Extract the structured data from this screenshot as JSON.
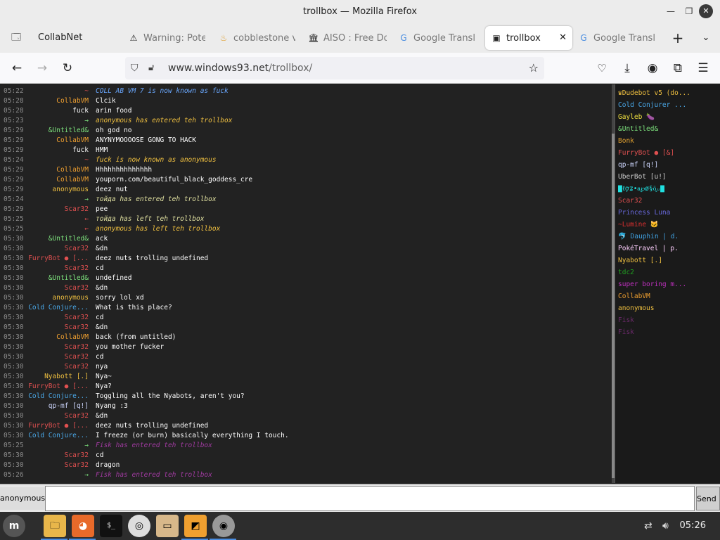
{
  "window": {
    "title": "trollbox — Mozilla Firefox"
  },
  "tabs": [
    {
      "label": "CollabNet",
      "icon": "tab-list-icon"
    },
    {
      "label": "Warning: Pote",
      "icon": "warning-icon"
    },
    {
      "label": "cobblestone v",
      "icon": "flame-icon"
    },
    {
      "label": "AISO : Free Do",
      "icon": "archive-icon"
    },
    {
      "label": "Google Transl",
      "icon": "translate-icon"
    },
    {
      "label": "trollbox",
      "icon": "trollbox-icon"
    },
    {
      "label": "Google Transl",
      "icon": "translate-icon"
    }
  ],
  "nav": {
    "url_host": "www.windows93.net",
    "url_path": "/trollbox/"
  },
  "colors": {
    "time": "#8a8a8a",
    "system_arrow": "#7ce07c",
    "leave_arrow": "#e05050"
  },
  "messages": [
    {
      "time": "05:22",
      "nick": "~",
      "nick_color": "#e05050",
      "text": "",
      "sys": "COLL AB VM 7 is now known as fuck",
      "sys_color": "#6aa8ff"
    },
    {
      "time": "05:28",
      "nick": "CollabVM",
      "nick_color": "#f0a030",
      "text": "Clcik"
    },
    {
      "time": "05:28",
      "nick": "fuck",
      "nick_color": "#f5f5f5",
      "text": "arin food"
    },
    {
      "time": "05:23",
      "nick": "→",
      "nick_color": "#7ce07c",
      "text": "",
      "sys": "anonymous has entered teh trollbox",
      "sys_color": "#f0c040"
    },
    {
      "time": "05:29",
      "nick": "&Untitled&",
      "nick_color": "#7ce07c",
      "text": "oh god no"
    },
    {
      "time": "05:29",
      "nick": "CollabVM",
      "nick_color": "#f0a030",
      "text": "ANYNYMOOOOSE GONG TO HACK"
    },
    {
      "time": "05:29",
      "nick": "fuck",
      "nick_color": "#f5f5f5",
      "text": "HMM"
    },
    {
      "time": "05:24",
      "nick": "~",
      "nick_color": "#e05050",
      "text": "",
      "sys": "fuck is now known as anonymous",
      "sys_color": "#f0c040"
    },
    {
      "time": "05:29",
      "nick": "CollabVM",
      "nick_color": "#f0a030",
      "text": "Hhhhhhhhhhhhhh"
    },
    {
      "time": "05:29",
      "nick": "CollabVM",
      "nick_color": "#f0a030",
      "text": "youporn.com/beautiful_black_goddess_cre"
    },
    {
      "time": "05:29",
      "nick": "anonymous",
      "nick_color": "#f0c040",
      "text": "deez nut"
    },
    {
      "time": "05:24",
      "nick": "→",
      "nick_color": "#7ce07c",
      "text": "",
      "sys": "тойда has entered teh trollbox",
      "sys_color": "#e0e0a0"
    },
    {
      "time": "05:29",
      "nick": "Scar32",
      "nick_color": "#e05050",
      "text": "pee"
    },
    {
      "time": "05:25",
      "nick": "←",
      "nick_color": "#e05050",
      "text": "",
      "sys": "тойда has left teh trollbox",
      "sys_color": "#e0e0a0"
    },
    {
      "time": "05:25",
      "nick": "←",
      "nick_color": "#e05050",
      "text": "",
      "sys": "anonymous has left teh trollbox",
      "sys_color": "#f0c040"
    },
    {
      "time": "05:30",
      "nick": "&Untitled&",
      "nick_color": "#7ce07c",
      "text": "ack"
    },
    {
      "time": "05:30",
      "nick": "Scar32",
      "nick_color": "#e05050",
      "text": "&dn"
    },
    {
      "time": "05:30",
      "nick": "FurryBot ● [...",
      "nick_color": "#e05050",
      "text": "deez nuts trolling undefined"
    },
    {
      "time": "05:30",
      "nick": "Scar32",
      "nick_color": "#e05050",
      "text": "cd"
    },
    {
      "time": "05:30",
      "nick": "&Untitled&",
      "nick_color": "#7ce07c",
      "text": "undefined"
    },
    {
      "time": "05:30",
      "nick": "Scar32",
      "nick_color": "#e05050",
      "text": "&dn"
    },
    {
      "time": "05:30",
      "nick": "anonymous",
      "nick_color": "#f0c040",
      "text": "sorry lol xd"
    },
    {
      "time": "05:30",
      "nick": "Cold Conjure...",
      "nick_color": "#4aa8e8",
      "text": "What is this place?"
    },
    {
      "time": "05:30",
      "nick": "Scar32",
      "nick_color": "#e05050",
      "text": "cd"
    },
    {
      "time": "05:30",
      "nick": "Scar32",
      "nick_color": "#e05050",
      "text": "&dn"
    },
    {
      "time": "05:30",
      "nick": "CollabVM",
      "nick_color": "#f0a030",
      "text": "back (from untitled)"
    },
    {
      "time": "05:30",
      "nick": "Scar32",
      "nick_color": "#e05050",
      "text": "you mother fucker"
    },
    {
      "time": "05:30",
      "nick": "Scar32",
      "nick_color": "#e05050",
      "text": "cd"
    },
    {
      "time": "05:30",
      "nick": "Scar32",
      "nick_color": "#e05050",
      "text": "nya"
    },
    {
      "time": "05:30",
      "nick": "Nyabott [.]",
      "nick_color": "#f0c040",
      "text": "Nya~"
    },
    {
      "time": "05:30",
      "nick": "FurryBot ● [...",
      "nick_color": "#e05050",
      "text": "Nya?"
    },
    {
      "time": "05:30",
      "nick": "Cold Conjure...",
      "nick_color": "#4aa8e8",
      "text": "Toggling all the Nyabots, aren't you?"
    },
    {
      "time": "05:30",
      "nick": "qp-mf [q!]",
      "nick_color": "#cfd8ff",
      "text": "Nyang :3"
    },
    {
      "time": "05:30",
      "nick": "Scar32",
      "nick_color": "#e05050",
      "text": "&dn"
    },
    {
      "time": "05:30",
      "nick": "FurryBot ● [...",
      "nick_color": "#e05050",
      "text": "deez nuts trolling undefined"
    },
    {
      "time": "05:30",
      "nick": "Cold Conjure...",
      "nick_color": "#4aa8e8",
      "text": "I freeze (or burn) basically everything I touch."
    },
    {
      "time": "05:25",
      "nick": "→",
      "nick_color": "#7ce07c",
      "text": "",
      "sys": "Fisk has entered teh trollbox",
      "sys_color": "#a03aa0"
    },
    {
      "time": "05:30",
      "nick": "Scar32",
      "nick_color": "#e05050",
      "text": "cd"
    },
    {
      "time": "05:30",
      "nick": "Scar32",
      "nick_color": "#e05050",
      "text": "dragon"
    },
    {
      "time": "05:26",
      "nick": "→",
      "nick_color": "#7ce07c",
      "text": "",
      "sys": "Fisk has entered teh trollbox",
      "sys_color": "#a03aa0"
    }
  ],
  "users": [
    {
      "name": "♛Dudebot v5 (do...",
      "color": "#f0c040"
    },
    {
      "name": "Cold Conjurer ...",
      "color": "#4aa8e8"
    },
    {
      "name": "Gayleb 🍆",
      "color": "#f0e040"
    },
    {
      "name": "&Untitled&",
      "color": "#7ce07c"
    },
    {
      "name": "Bonk",
      "color": "#e0a030"
    },
    {
      "name": "FurryBot ● [&]",
      "color": "#e05050"
    },
    {
      "name": "qp-mf [q!]",
      "color": "#cfd8ff"
    },
    {
      "name": "UberBot [u!]",
      "color": "#cccccc"
    },
    {
      "name": "▇ℓợʑ•ᴕ℘ø§ö͓ᵤ▇",
      "color": "#20e0e0"
    },
    {
      "name": "Scar32",
      "color": "#e05050"
    },
    {
      "name": "Princess Luna",
      "color": "#6a6ae0"
    },
    {
      "name": "~Lumine 🐱",
      "color": "#e03030"
    },
    {
      "name": "🐬 Dauphin | d.",
      "color": "#40a0e0"
    },
    {
      "name": "PokéTravel | p.",
      "color": "#ffd0ff"
    },
    {
      "name": "Nyabott [.]",
      "color": "#f0c040"
    },
    {
      "name": "tdc2",
      "color": "#20a020"
    },
    {
      "name": "super boring m...",
      "color": "#c030c0"
    },
    {
      "name": "CollabVM",
      "color": "#f0a030"
    },
    {
      "name": "anonymous",
      "color": "#f0c040"
    },
    {
      "name": "Fisk",
      "color": "#6a2a6a"
    },
    {
      "name": "Fisk",
      "color": "#6a2a6a"
    }
  ],
  "input": {
    "nick": "anonymous",
    "send": "Send",
    "value": ""
  },
  "taskbar": {
    "clock": "05:26"
  }
}
